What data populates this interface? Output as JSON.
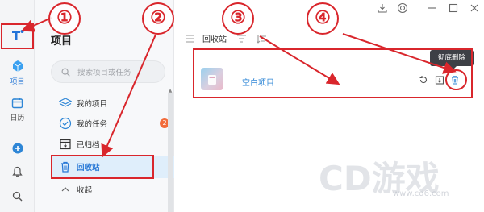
{
  "window": {
    "controls": [
      "download-icon",
      "sync-icon",
      "minimize-icon",
      "maximize-icon",
      "close-icon"
    ]
  },
  "rail": {
    "logo_icon": "app-logo-icon",
    "items": [
      {
        "label": "项目",
        "icon": "cube-icon"
      },
      {
        "label": "日历",
        "icon": "calendar-icon"
      }
    ],
    "add_icon": "plus-circle-icon",
    "bell_icon": "bell-icon",
    "search_icon": "search-icon"
  },
  "panel": {
    "title": "项目",
    "search_placeholder": "搜索项目或任务",
    "nav": [
      {
        "label": "我的项目",
        "icon": "layers-icon"
      },
      {
        "label": "我的任务",
        "icon": "check-circle-icon",
        "badge": "2"
      },
      {
        "label": "已归档",
        "icon": "archive-icon"
      },
      {
        "label": "回收站",
        "icon": "trash-icon"
      },
      {
        "label": "收起",
        "icon": "chevron-up-icon"
      }
    ]
  },
  "main": {
    "toolbar_title": "回收站",
    "project": {
      "name": "空白项目"
    },
    "tooltip": "彻底删除",
    "actions": [
      "restore-icon",
      "export-icon",
      "delete-icon"
    ]
  },
  "annotations": [
    "①",
    "②",
    "③",
    "④"
  ],
  "watermark": {
    "logo": "CD游戏",
    "url": "www.cd6.com"
  },
  "colors": {
    "accent": "#2e86d6",
    "annotation_red": "#d9262c",
    "badge": "#f26b3a"
  }
}
